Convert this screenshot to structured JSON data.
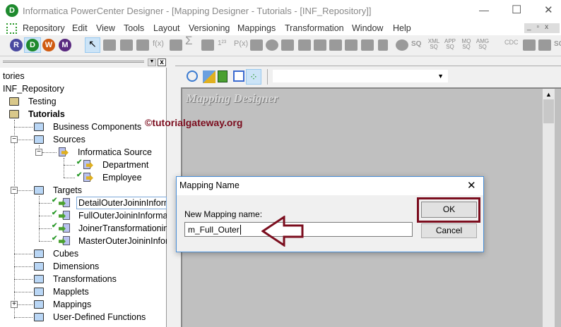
{
  "window": {
    "title": "Informatica PowerCenter Designer - [Mapping Designer - Tutorials - [INF_Repository]]",
    "minimize": "—",
    "maximize": "☐",
    "close": "✕"
  },
  "menu": [
    "Repository",
    "Edit",
    "View",
    "Tools",
    "Layout",
    "Versioning",
    "Mappings",
    "Transformation",
    "Window",
    "Help"
  ],
  "tool_logos": [
    "R",
    "D",
    "W",
    "M"
  ],
  "toolbar_text": {
    "fx": "f(x)",
    "px": "P(x)",
    "sq": "SQ",
    "xml": "XML SQ",
    "app": "APP SQ",
    "mq": "MQ SQ",
    "amg": "AMG SQ",
    "cdc": "CDC",
    "sq2": "SQ"
  },
  "navigator": {
    "items": [
      "tories",
      "INF_Repository",
      "Testing",
      "Tutorials",
      "Business Components",
      "Sources",
      "Informatica Source",
      "Department",
      "Employee",
      "Targets",
      "DetailOuterJoininInform",
      "FullOuterJoininInformat",
      "JoinerTransformationinI",
      "MasterOuterJoininInform",
      "Cubes",
      "Dimensions",
      "Transformations",
      "Mapplets",
      "Mappings",
      "User-Defined Functions"
    ],
    "close": "x"
  },
  "workspace": {
    "label": "Mapping Designer",
    "watermark": "©tutorialgateway.org"
  },
  "dialog": {
    "title": "Mapping Name",
    "close": "✕",
    "field_label": "New Mapping name:",
    "field_value": "m_Full_Outer",
    "ok": "OK",
    "cancel": "Cancel"
  },
  "colors": {
    "highlight": "#7b0d1e",
    "canvas": "#c0c0c0"
  }
}
